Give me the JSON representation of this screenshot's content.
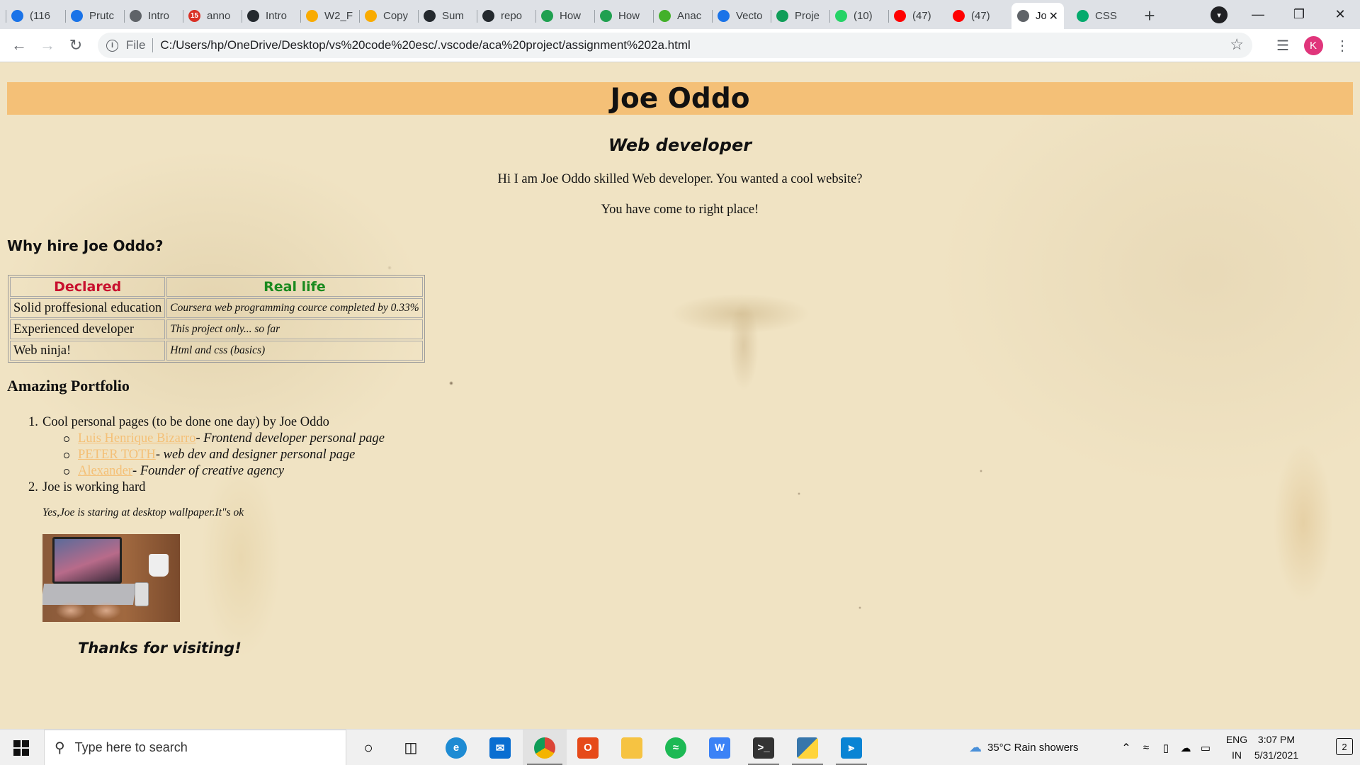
{
  "browser": {
    "tabs": [
      {
        "title": "(116",
        "icon": "chrome-icon",
        "color": "#1a73e8"
      },
      {
        "title": "Prutc",
        "icon": "diamond-icon",
        "color": "#1a73e8"
      },
      {
        "title": "Intro",
        "icon": "globe-icon",
        "color": "#5f6368"
      },
      {
        "title": "anno",
        "icon": "notification-badge-icon",
        "color": "#d93025",
        "badge": "15"
      },
      {
        "title": "Intro",
        "icon": "github-icon",
        "color": "#24292e"
      },
      {
        "title": "W2_F",
        "icon": "colab-icon",
        "color": "#f9ab00"
      },
      {
        "title": "Copy",
        "icon": "colab-icon",
        "color": "#f9ab00"
      },
      {
        "title": "Sum",
        "icon": "github-icon",
        "color": "#24292e"
      },
      {
        "title": "repo",
        "icon": "github-icon",
        "color": "#24292e"
      },
      {
        "title": "How",
        "icon": "infinity-icon",
        "color": "#20a050"
      },
      {
        "title": "How",
        "icon": "infinity-icon",
        "color": "#20a050"
      },
      {
        "title": "Anac",
        "icon": "circle-icon",
        "color": "#43b02a"
      },
      {
        "title": "Vecto",
        "icon": "c-logo-icon",
        "color": "#1a73e8"
      },
      {
        "title": "Proje",
        "icon": "plus-sheet-icon",
        "color": "#0f9d58"
      },
      {
        "title": "(10)",
        "icon": "whatsapp-icon",
        "color": "#25d366"
      },
      {
        "title": "(47)",
        "icon": "youtube-icon",
        "color": "#ff0000"
      },
      {
        "title": "(47)",
        "icon": "youtube-icon",
        "color": "#ff0000"
      },
      {
        "title": "Jo",
        "icon": "globe-icon",
        "color": "#5f6368",
        "active": true
      },
      {
        "title": "CSS",
        "icon": "w3schools-icon",
        "color": "#04aa6d"
      }
    ],
    "new_tab": "+",
    "address": {
      "scheme": "File",
      "url": "C:/Users/hp/OneDrive/Desktop/vs%20code%20esc/.vscode/aca%20project/assignment%202a.html"
    },
    "profile_initial": "K"
  },
  "page": {
    "heading": "Joe Oddo",
    "subtitle": "Web developer",
    "intro_line1": "Hi I am Joe Oddo skilled Web developer. You wanted a cool website?",
    "intro_line2": "You have come to right place!",
    "why_heading": "Why hire Joe Oddo?",
    "table": {
      "headers": [
        "Declared",
        "Real life"
      ],
      "rows": [
        [
          "Solid proffesional education",
          "Coursera web programming cource completed by 0.33%"
        ],
        [
          "Experienced developer",
          "This project only... so far"
        ],
        [
          "Web ninja!",
          "Html and css (basics)"
        ]
      ],
      "colors": {
        "declared": "#c8102e",
        "real_life": "#1a8a1f"
      }
    },
    "portfolio_heading": "Amazing Portfolio",
    "list": [
      {
        "number": "1.",
        "text": "Cool personal pages (to be done one day) by Joe Oddo",
        "links": [
          {
            "name": "Luis Henrique Bizarro",
            "desc": "- Frontend developer personal page"
          },
          {
            "name": "PETER TOTH",
            "desc": "- web dev and designer personal page"
          },
          {
            "name": "Alexander",
            "desc": "- Founder of creative agency"
          }
        ]
      },
      {
        "number": "2.",
        "text": "Joe is working hard"
      }
    ],
    "caption": "Yes,Joe is staring at desktop wallpaper.It\"s ok",
    "photo": "laptop-desk-photo",
    "thanks": "Thanks for visiting!",
    "accent_color": "#f4c077"
  },
  "taskbar": {
    "search_placeholder": "Type here to search",
    "weather": "35°C  Rain showers",
    "lang_line1": "ENG",
    "lang_line2": "IN",
    "time": "3:07 PM",
    "date": "5/31/2021",
    "notifications": "2"
  }
}
